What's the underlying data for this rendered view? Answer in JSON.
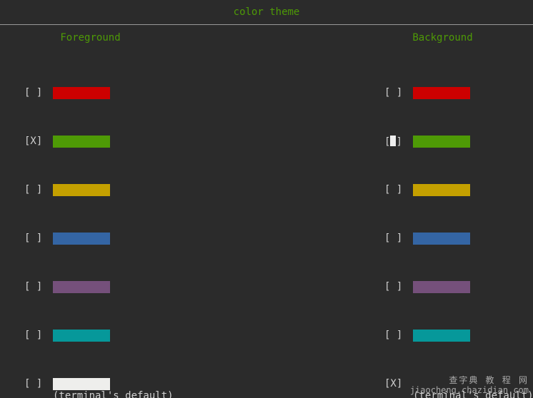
{
  "title": "color theme",
  "headers": {
    "fg": "Foreground",
    "bg": "Background"
  },
  "colors": {
    "red": "#cc0000",
    "green": "#4e9a06",
    "yellow": "#c4a000",
    "blue": "#3465a4",
    "purple": "#75507b",
    "cyan": "#06989a",
    "white": "#eeeeec"
  },
  "fg_items": [
    {
      "id": "red",
      "checked": false,
      "caption": ""
    },
    {
      "id": "green",
      "checked": true,
      "caption": ""
    },
    {
      "id": "yellow",
      "checked": false,
      "caption": ""
    },
    {
      "id": "blue",
      "checked": false,
      "caption": ""
    },
    {
      "id": "purple",
      "checked": false,
      "caption": ""
    },
    {
      "id": "cyan",
      "checked": false,
      "caption": ""
    },
    {
      "id": "white",
      "checked": false,
      "caption": "(terminal's default)"
    }
  ],
  "bg_items": [
    {
      "id": "red",
      "checked": false,
      "cursor": false,
      "caption": ""
    },
    {
      "id": "green",
      "checked": false,
      "cursor": true,
      "caption": ""
    },
    {
      "id": "yellow",
      "checked": false,
      "cursor": false,
      "caption": ""
    },
    {
      "id": "blue",
      "checked": false,
      "cursor": false,
      "caption": ""
    },
    {
      "id": "purple",
      "checked": false,
      "cursor": false,
      "caption": ""
    },
    {
      "id": "cyan",
      "checked": false,
      "cursor": false,
      "caption": ""
    },
    {
      "id": "white",
      "checked": true,
      "cursor": false,
      "caption": "(terminal's default)",
      "hide_swatch": true
    }
  ],
  "checkbox_glyphs": {
    "off": "[ ]",
    "on": "[X]"
  },
  "watermark": {
    "line1": "查字典 教 程 网",
    "line2": "jiaocheng.chazidian.com"
  }
}
